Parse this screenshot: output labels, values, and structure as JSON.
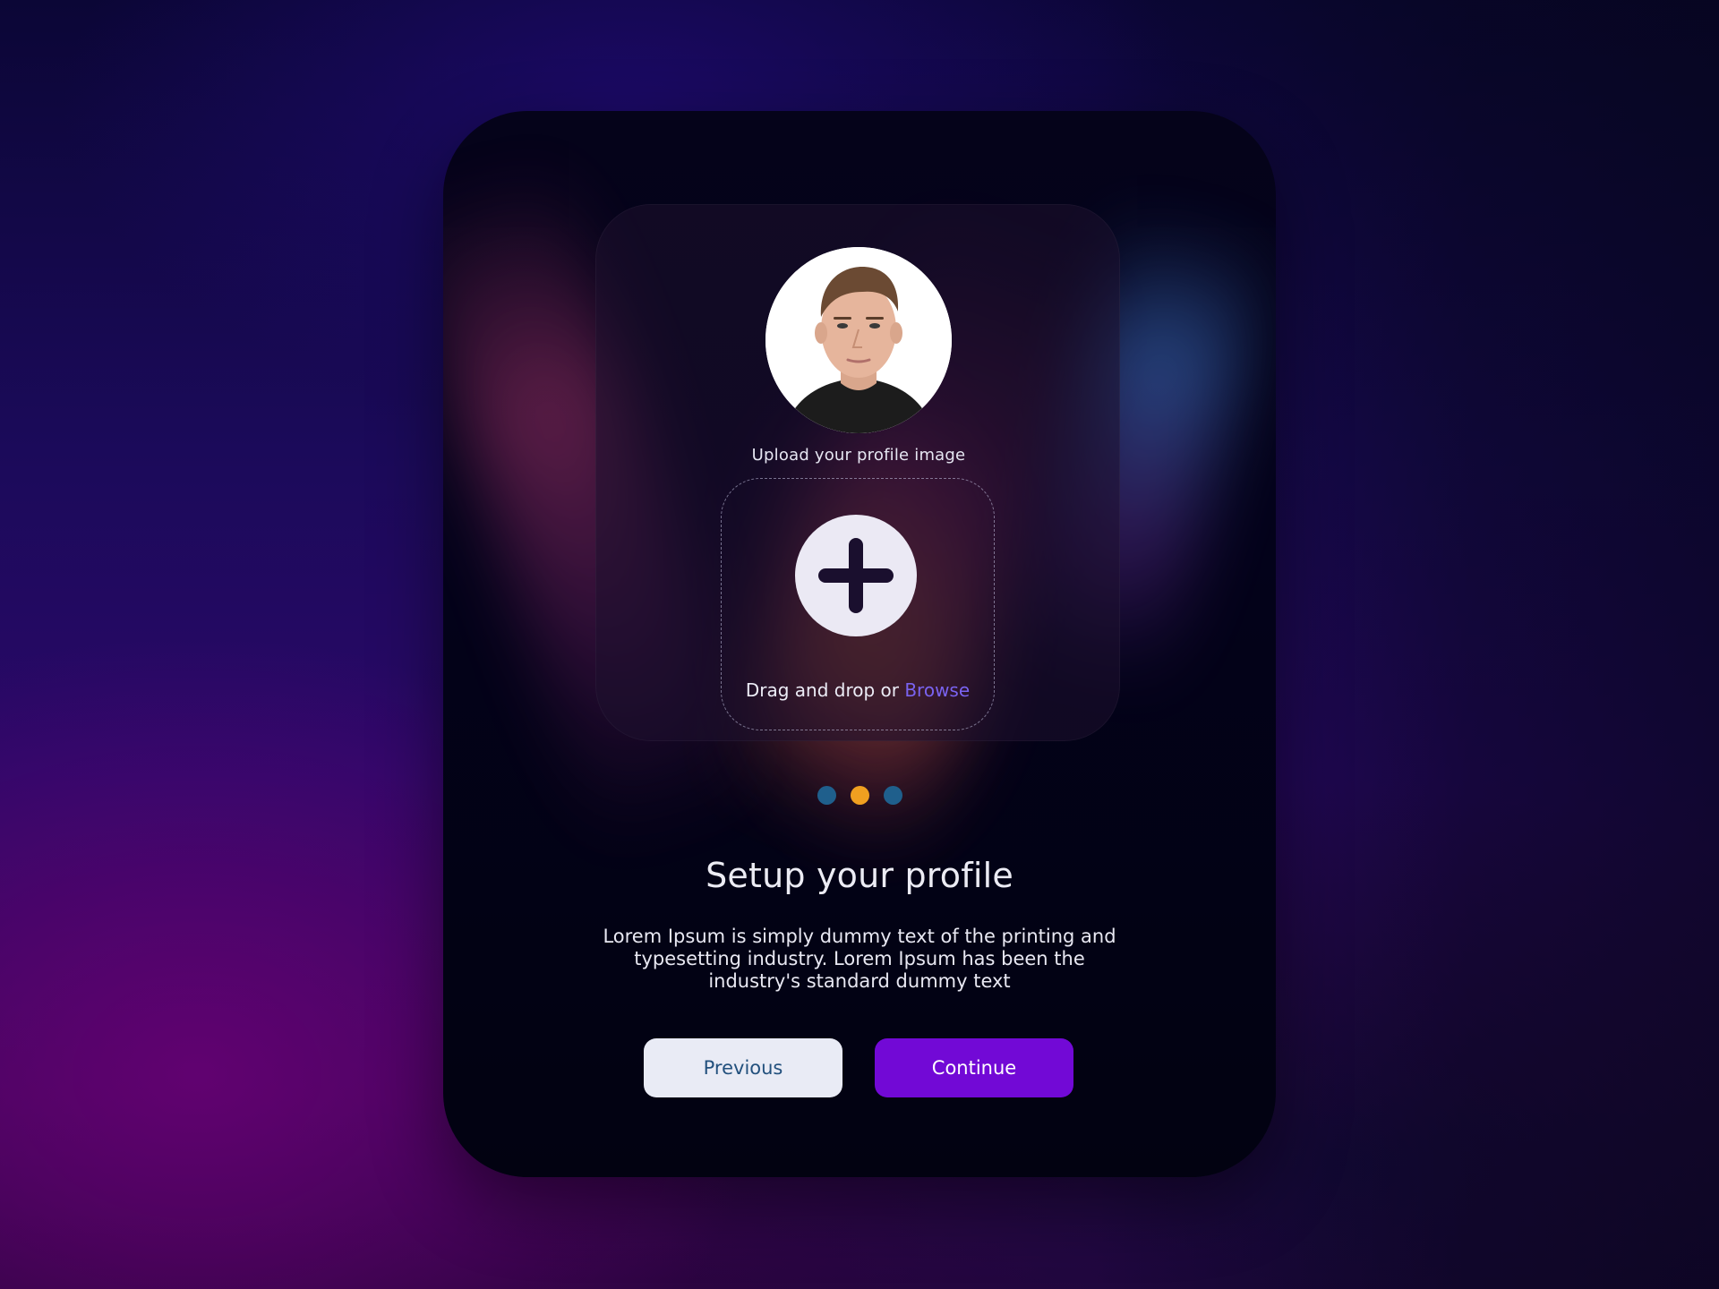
{
  "upload": {
    "caption": "Upload your profile image",
    "drop_text": "Drag and drop or ",
    "browse_label": "Browse",
    "add_icon": "plus-icon",
    "avatar_icon": "avatar"
  },
  "pager": {
    "dots": [
      {
        "color": "#1f5f8c",
        "active": false
      },
      {
        "color": "#f0a020",
        "active": true
      },
      {
        "color": "#1f5f8c",
        "active": false
      }
    ]
  },
  "content": {
    "title": "Setup your profile",
    "description": "Lorem Ipsum is simply dummy text of the printing and typesetting industry. Lorem Ipsum has been the industry's standard dummy text"
  },
  "actions": {
    "previous_label": "Previous",
    "continue_label": "Continue"
  },
  "colors": {
    "accent": "#7209d6",
    "link": "#7a63f0",
    "secondary_button_bg": "#e9ebf5",
    "secondary_button_text": "#22507d"
  }
}
